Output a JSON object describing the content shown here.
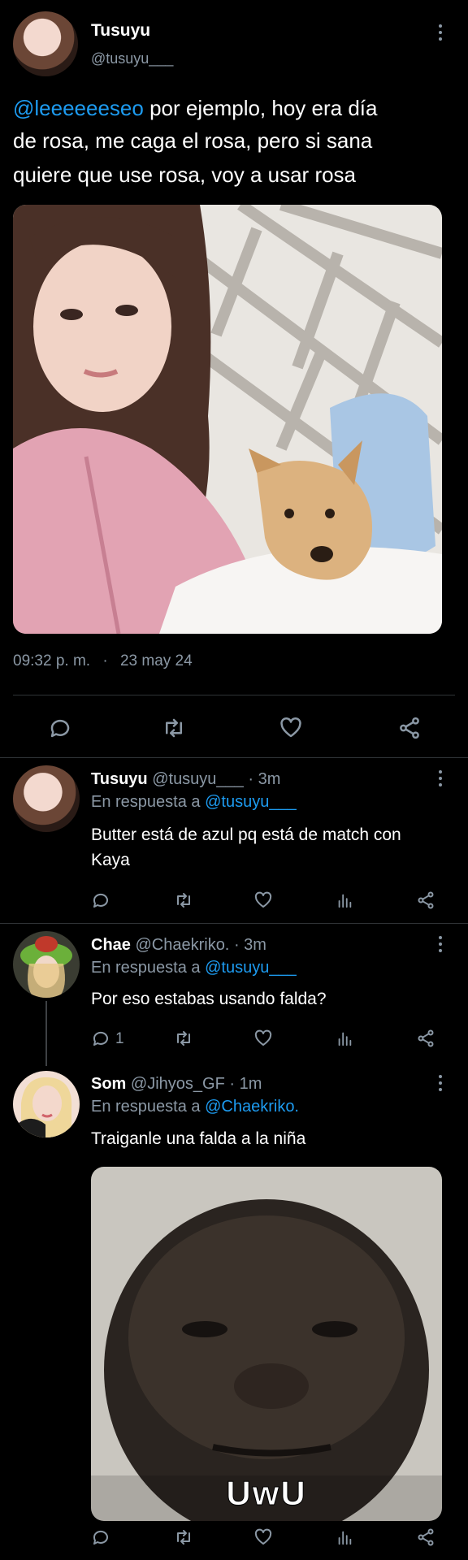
{
  "main_tweet": {
    "display_name": "Tusuyu",
    "handle": "@tusuyu___",
    "mention": "@leeeeeeseo",
    "text_line1_rest": " por ejemplo, hoy era día",
    "text_line2": "de rosa, me caga el rosa, pero si sana",
    "text_line3": "quiere que use rosa, voy a usar rosa",
    "time": "09:32 p. m.",
    "separator": "·",
    "date": "23 may 24"
  },
  "replies": [
    {
      "display_name": "Tusuyu",
      "handle": "@tusuyu___",
      "age": "· 3m",
      "reply_prefix": "En respuesta a ",
      "reply_to": "@tusuyu___",
      "text_line1": "Butter está de azul pq está de match con",
      "text_line2": "Kaya"
    },
    {
      "display_name": "Chae",
      "handle": "@Chaekriko.",
      "age": "· 3m",
      "reply_prefix": "En respuesta a ",
      "reply_to": "@tusuyu___",
      "text_line1": "Por eso estabas usando falda?",
      "reply_count": "1"
    },
    {
      "display_name": "Som",
      "handle": "@Jihyos_GF",
      "age": "· 1m",
      "reply_prefix": "En respuesta a ",
      "reply_to": "@Chaekriko.",
      "text_line1": "Traiganle una falda a la niña",
      "image_caption": "UwU"
    }
  ],
  "colors": {
    "background": "#000000",
    "link": "#1d9bf0",
    "secondary_text": "#8b98a5",
    "divider": "#2f3336"
  },
  "icons": [
    "reply-icon",
    "retweet-icon",
    "like-icon",
    "share-icon",
    "analytics-icon",
    "more-icon"
  ]
}
